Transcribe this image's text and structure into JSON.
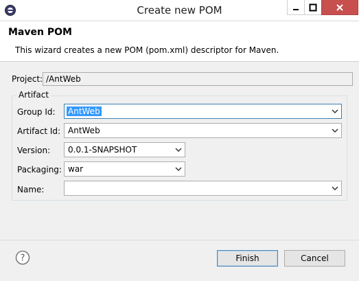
{
  "window": {
    "title": "Create new POM"
  },
  "banner": {
    "title": "Maven POM",
    "description": "This wizard creates a new POM (pom.xml) descriptor for Maven."
  },
  "project": {
    "label": "Project:",
    "value": "/AntWeb"
  },
  "artifact": {
    "group_label": "Artifact",
    "group_id": {
      "label": "Group Id:",
      "value": "AntWeb"
    },
    "artifact_id": {
      "label": "Artifact Id:",
      "value": "AntWeb"
    },
    "version": {
      "label": "Version:",
      "value": "0.0.1-SNAPSHOT"
    },
    "packaging": {
      "label": "Packaging:",
      "value": "war"
    },
    "name": {
      "label": "Name:",
      "value": ""
    }
  },
  "buttons": {
    "finish": "Finish",
    "cancel": "Cancel"
  },
  "icons": {
    "app": "eclipse-icon",
    "help": "help-icon",
    "minimize": "minimize-icon",
    "maximize": "maximize-icon",
    "close": "close-icon"
  },
  "colors": {
    "close_button": "#c7504f",
    "selection": "#3399ff"
  }
}
